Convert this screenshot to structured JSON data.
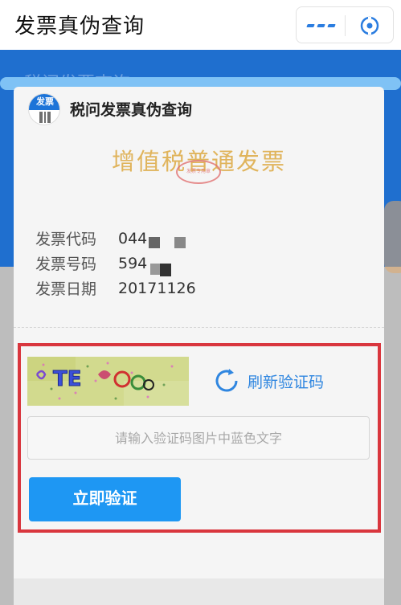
{
  "topbar": {
    "title": "发票真伪查询",
    "more_icon": "more-dots-icon",
    "close_icon": "target-close-icon"
  },
  "background": {
    "ghost_title": "税问发票查询",
    "accent": "#1f6fcf"
  },
  "card": {
    "logo_text": "发票",
    "title": "税问发票真伪查询",
    "invoice_type": "增值税普通发票",
    "stamp_text": "发票专用章",
    "fields": [
      {
        "label": "发票代码",
        "value": "044"
      },
      {
        "label": "发票号码",
        "value": "594"
      },
      {
        "label": "发票日期",
        "value": "20171126"
      }
    ]
  },
  "verify": {
    "captcha_text": "TE",
    "refresh_label": "刷新验证码",
    "input_placeholder": "请输入验证码图片中蓝色文字",
    "input_value": "",
    "submit_label": "立即验证",
    "highlight_color": "#d9363e",
    "button_color": "#1e97f3"
  }
}
